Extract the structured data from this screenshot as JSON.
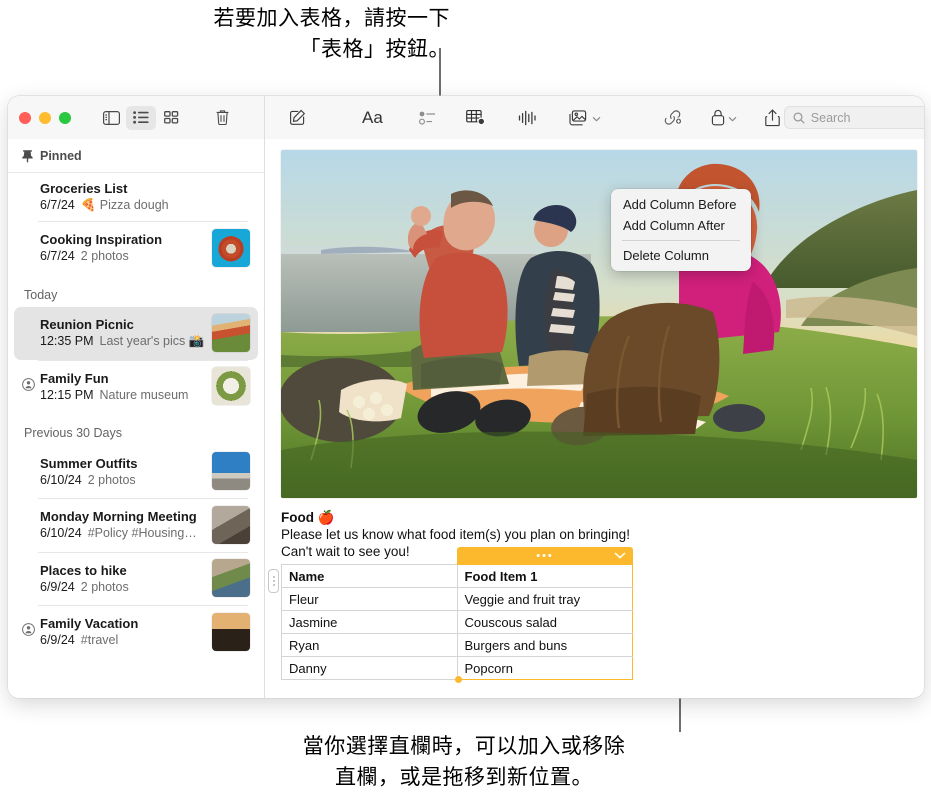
{
  "annotations": {
    "top": "若要加入表格，請按一下\n「表格」按鈕。",
    "bottom": "當你選擇直欄時，可以加入或移除\n直欄，或是拖移到新位置。"
  },
  "window": {
    "traffic_lights": [
      "close",
      "minimize",
      "zoom"
    ],
    "sidebar_toolbar": [
      {
        "name": "sidebar-toggle",
        "icon": "sidebar-icon",
        "active": false
      },
      {
        "name": "list-view",
        "icon": "list-view-icon",
        "active": true
      },
      {
        "name": "gallery-view",
        "icon": "gallery-view-icon",
        "active": false
      },
      {
        "name": "delete",
        "icon": "trash-icon",
        "active": false
      }
    ],
    "note_toolbar": [
      {
        "name": "compose",
        "icon": "compose-icon"
      },
      {
        "name": "format",
        "icon": "aa-format-icon",
        "label": "Aa"
      },
      {
        "name": "checklist",
        "icon": "checklist-icon"
      },
      {
        "name": "table",
        "icon": "table-icon"
      },
      {
        "name": "audio",
        "icon": "audio-waveform-icon"
      },
      {
        "name": "media",
        "icon": "media-icon",
        "chevron": true
      },
      {
        "name": "link",
        "icon": "link-add-icon"
      },
      {
        "name": "lock",
        "icon": "lock-icon",
        "chevron": true
      },
      {
        "name": "share",
        "icon": "share-icon"
      }
    ],
    "search": {
      "placeholder": "Search",
      "value": "",
      "icon": "search-icon"
    }
  },
  "sidebar": {
    "pinned_header": {
      "label": "Pinned",
      "icon": "pin-icon"
    },
    "pinned": [
      {
        "title": "Groceries List",
        "date": "6/7/24",
        "preview": "🍕 Pizza dough",
        "thumb": false,
        "shared": false
      },
      {
        "title": "Cooking Inspiration",
        "date": "6/7/24",
        "preview": "2 photos",
        "thumb": true,
        "shared": false
      }
    ],
    "groups": [
      {
        "header": "Today",
        "notes": [
          {
            "title": "Reunion Picnic",
            "date": "12:35 PM",
            "preview": "Last year's pics 📸",
            "thumb": true,
            "shared": false,
            "selected": true
          },
          {
            "title": "Family Fun",
            "date": "12:15 PM",
            "preview": "Nature museum",
            "thumb": true,
            "shared": true,
            "selected": false
          }
        ]
      },
      {
        "header": "Previous 30 Days",
        "notes": [
          {
            "title": "Summer Outfits",
            "date": "6/10/24",
            "preview": "2 photos",
            "thumb": true,
            "shared": false,
            "selected": false
          },
          {
            "title": "Monday Morning Meeting",
            "date": "6/10/24",
            "preview": "#Policy #Housing…",
            "thumb": true,
            "shared": false,
            "selected": false
          },
          {
            "title": "Places to hike",
            "date": "6/9/24",
            "preview": "2 photos",
            "thumb": true,
            "shared": false,
            "selected": false
          },
          {
            "title": "Family Vacation",
            "date": "6/9/24",
            "preview": "#travel",
            "thumb": true,
            "shared": true,
            "selected": false
          }
        ]
      }
    ]
  },
  "note": {
    "photo_alt": "Three people sitting on an orange picnic blanket on a grassy cliff at sunset",
    "heading": "Food 🍎",
    "paragraph_1": "Please let us know what food item(s) you plan on bringing!",
    "paragraph_2": "Can't wait to see you!",
    "table": {
      "columns": [
        "Name",
        "Food Item 1"
      ],
      "selected_column_index": 1,
      "rows": [
        [
          "Fleur",
          "Veggie and fruit tray"
        ],
        [
          "Jasmine",
          "Couscous salad"
        ],
        [
          "Ryan",
          "Burgers and buns"
        ],
        [
          "Danny",
          "Popcorn"
        ]
      ]
    }
  },
  "context_menu": {
    "items": [
      {
        "label": "Add Column Before",
        "divider_after": false
      },
      {
        "label": "Add Column After",
        "divider_after": true
      },
      {
        "label": "Delete Column",
        "divider_after": false
      }
    ]
  },
  "colors": {
    "selection_yellow": "#fdb92e",
    "sidebar_selected": "#e4e4e4",
    "toolbar_bg": "#f7f7f7",
    "traffic_red": "#ff5f57",
    "traffic_yellow": "#febc2e",
    "traffic_green": "#28c840"
  }
}
